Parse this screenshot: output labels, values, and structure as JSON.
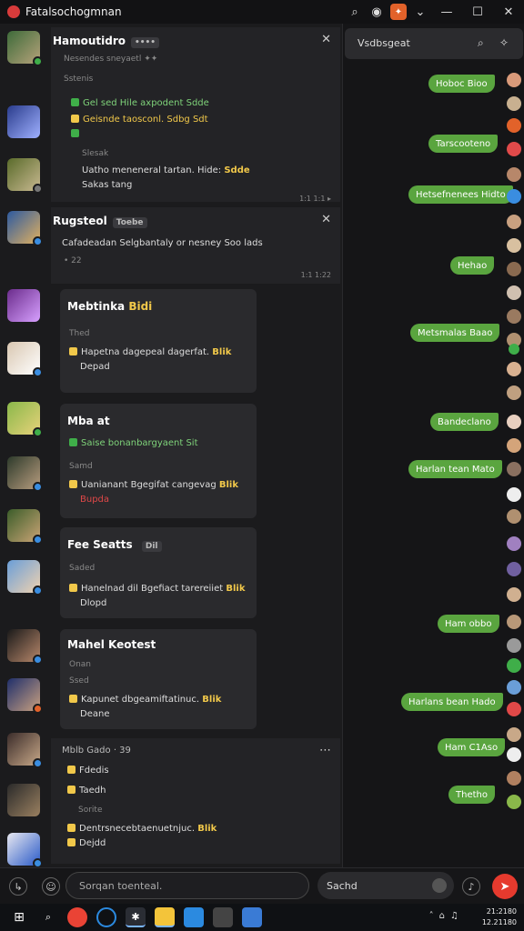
{
  "window": {
    "title": "Fatalsochogmnan",
    "controls": [
      "search",
      "record",
      "badge",
      "pin",
      "minimize",
      "maximize",
      "close"
    ]
  },
  "colors": {
    "accent_green": "#5aa53f",
    "accent_red": "#e63a2e",
    "highlight_yellow": "#f1c84a",
    "panel": "#2a2a2d"
  },
  "threads": [
    {
      "title": "Hamoutidro",
      "pill": "••••",
      "lines": [
        {
          "text": "Nesendes sneyaetl ✦✦",
          "style": "muted"
        },
        {
          "text": "Sstenis",
          "style": "muted"
        },
        {
          "text": "Gel sed Hile axpodent Sdde",
          "style": "green"
        },
        {
          "text": "Geisnde taosconl. Sdbg Sdt",
          "style": "yellow"
        },
        {
          "text": "Slesak",
          "style": "muted"
        },
        {
          "text": "Uatho meneneral tartan. Hide:",
          "highlight": "Sdde",
          "style": "normal"
        },
        {
          "text": "Sakas tang",
          "style": "normal"
        }
      ],
      "meta": "1:1 1:1 ▸"
    },
    {
      "title": "Rugsteol",
      "pill": "Toebe",
      "lines": [
        {
          "text": "Cafadeadan Selgbantaly or nesney Soo lads",
          "style": "normal"
        },
        {
          "text": "• 22",
          "style": "muted"
        }
      ],
      "meta": "1:1 1:22"
    },
    {
      "title": "Mebtinka",
      "badge": "Bidi",
      "lines": [
        {
          "text": "Thed",
          "style": "muted"
        },
        {
          "text": "Hapetna dagepeal dagerfat.",
          "highlight": "Blik",
          "style": "normal"
        },
        {
          "text": "Depad",
          "style": "normal"
        }
      ]
    },
    {
      "title": "Mba at",
      "lines": [
        {
          "text": "Saise bonanbargyaent Sit",
          "style": "green"
        },
        {
          "text": "Samd",
          "style": "muted"
        },
        {
          "text": "Uanianant Bgegifat cangevag",
          "highlight": "Blik",
          "style": "normal"
        },
        {
          "text": "Bupda",
          "style": "red"
        }
      ]
    },
    {
      "title": "Fee Seatts",
      "badge": "Dil",
      "lines": [
        {
          "text": "Saded",
          "style": "muted"
        },
        {
          "text": "Hanelnad dil Bgefiact tarereiiet",
          "highlight": "Blik",
          "style": "normal"
        },
        {
          "text": "Dlopd",
          "style": "normal"
        }
      ]
    },
    {
      "title": "Mahel Keotest",
      "lines": [
        {
          "text": "Onan",
          "style": "muted"
        },
        {
          "text": "Ssed",
          "style": "muted"
        },
        {
          "text": "Kapunet dbgeamiftatinuc.",
          "highlight": "Blik",
          "style": "normal"
        },
        {
          "text": "Deane",
          "style": "normal"
        }
      ]
    },
    {
      "title": "Mblb",
      "sub": "Gado · 39",
      "lines": [
        {
          "text": "Fdedis",
          "style": "normal"
        },
        {
          "text": "Taedh",
          "style": "normal"
        },
        {
          "text": "Sorite",
          "style": "muted"
        },
        {
          "text": "Dentrsnecebtaenuetnjuc.",
          "highlight": "Blik",
          "style": "normal"
        },
        {
          "text": "Dejdd",
          "style": "normal"
        }
      ]
    }
  ],
  "right_panel": {
    "title": "Vsdbsgeat",
    "bubbles": [
      "Hoboc Bioo",
      "Tarscooteno",
      "Hetsefnenees Hidto",
      "Hehao",
      "Metsmalas Baao",
      "Bandeclano",
      "Harlan tean Mato",
      "Ham obbo",
      "Harlans bean Hado",
      "Ham C1Aso",
      "Thetho"
    ]
  },
  "composer": {
    "placeholder": "Sorqan toenteal.",
    "search_label": "Sachd"
  },
  "taskbar": {
    "time": "21:2180",
    "date": "12.21180"
  }
}
